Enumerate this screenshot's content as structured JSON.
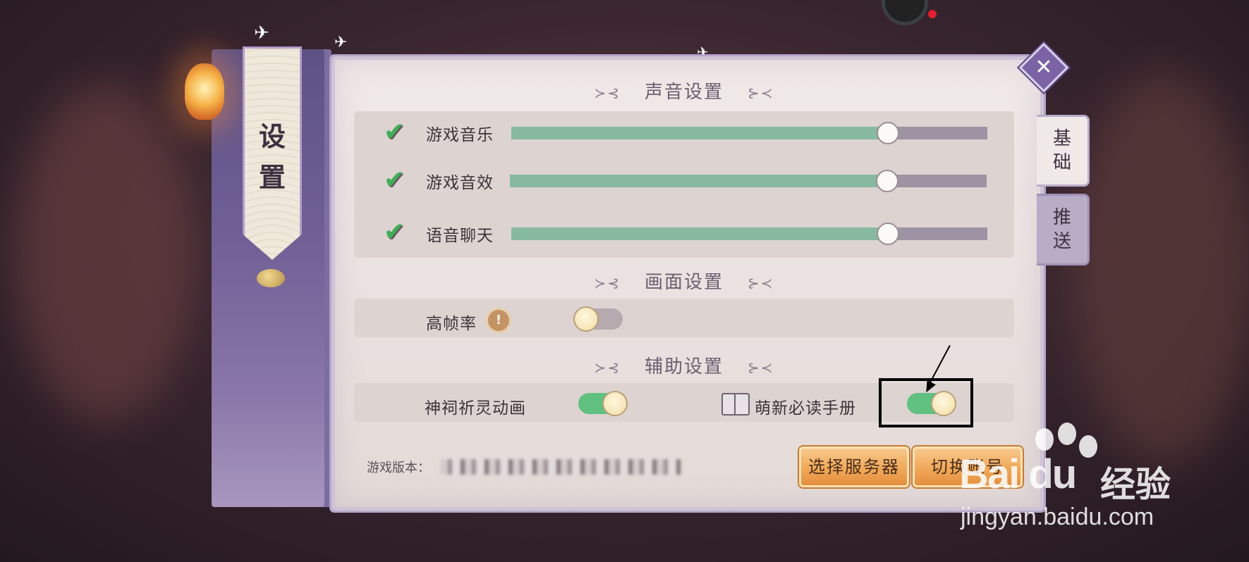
{
  "side_banner": {
    "title_line1": "设",
    "title_line2": "置"
  },
  "tabs": [
    {
      "label_line1": "基",
      "label_line2": "础",
      "active": true
    },
    {
      "label_line1": "推",
      "label_line2": "送",
      "active": false
    }
  ],
  "sections": {
    "sound": {
      "title": "声音设置",
      "items": [
        {
          "label": "游戏音乐",
          "checked": true,
          "level": 0.79
        },
        {
          "label": "游戏音效",
          "checked": true,
          "level": 0.79
        },
        {
          "label": "语音聊天",
          "checked": true,
          "level": 0.79
        }
      ]
    },
    "display": {
      "title": "画面设置",
      "high_fps_label": "高帧率",
      "high_fps_on": false,
      "info_icon": "!"
    },
    "assist": {
      "title": "辅助设置",
      "shrine_anim_label": "神祠祈灵动画",
      "shrine_anim_on": true,
      "newbie_manual_label": "萌新必读手册",
      "newbie_manual_on": true
    }
  },
  "footer": {
    "version_label": "游戏版本：",
    "select_server_label": "选择服务器",
    "switch_account_label": "切换账号"
  },
  "watermark": {
    "brand": "Bai du",
    "cn": "经验",
    "url": "jingyan.baidu.com"
  },
  "icons": {
    "close": "close-icon",
    "check": "checkmark-icon",
    "book": "book-icon",
    "info": "info-icon"
  },
  "colors": {
    "slider_fill": "#86b99f",
    "toggle_on": "#5fc080",
    "accent_purple": "#7b63a6",
    "button_gold": "#f0a858"
  }
}
